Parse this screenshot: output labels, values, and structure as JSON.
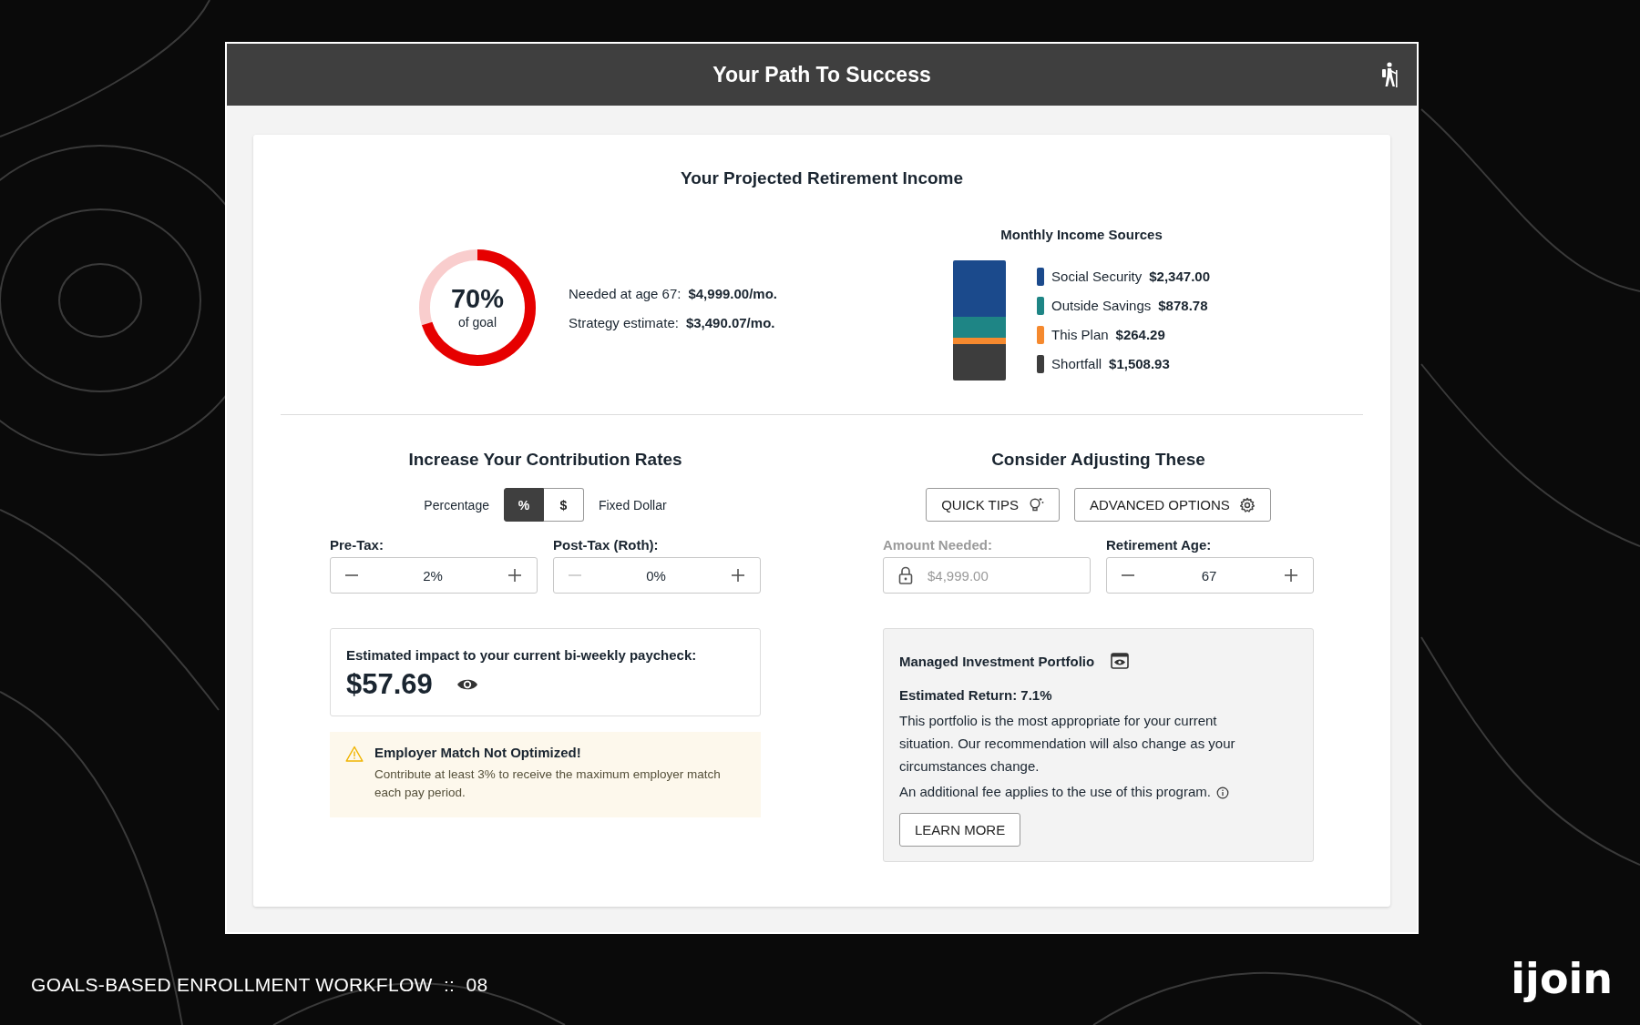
{
  "slide": {
    "caption": "GOALS-BASED ENROLLMENT WORKFLOW  ::  08",
    "logo": "ijoin"
  },
  "window": {
    "title": "Your Path To Success"
  },
  "projection": {
    "title": "Your Projected Retirement Income",
    "goal": {
      "percent": "70%",
      "caption": "of goal",
      "level": 0.7
    },
    "facts": [
      {
        "label": "Needed at age 67:",
        "value": "$4,999.00/mo."
      },
      {
        "label": "Strategy estimate:",
        "value": "$3,490.07/mo."
      }
    ],
    "sources": {
      "title": "Monthly Income Sources",
      "items": [
        {
          "name": "Social Security",
          "amount": "$2,347.00",
          "color": "#1b4a8c"
        },
        {
          "name": "Outside Savings",
          "amount": "$878.78",
          "color": "#1e8585"
        },
        {
          "name": "This Plan",
          "amount": "$264.29",
          "color": "#f5892e"
        },
        {
          "name": "Shortfall",
          "amount": "$1,508.93",
          "color": "#3d3d3d"
        }
      ]
    }
  },
  "contributions": {
    "title": "Increase Your Contribution Rates",
    "toggle": {
      "left_label": "Percentage",
      "right_label": "Fixed Dollar",
      "options": [
        {
          "label": "%",
          "selected": true
        },
        {
          "label": "$",
          "selected": false
        }
      ]
    },
    "steppers": [
      {
        "label": "Pre-Tax:",
        "value": "2%",
        "minus_disabled": false
      },
      {
        "label": "Post-Tax (Roth):",
        "value": "0%",
        "minus_disabled": true
      }
    ],
    "impact": {
      "label": "Estimated impact to your current bi-weekly paycheck:",
      "amount": "$57.69"
    },
    "alert": {
      "title": "Employer Match Not Optimized!",
      "text": "Contribute at least 3% to receive the maximum employer match each pay period."
    }
  },
  "adjust": {
    "title": "Consider Adjusting These",
    "buttons": [
      {
        "label": "QUICK TIPS",
        "kind": "tips"
      },
      {
        "label": "ADVANCED OPTIONS",
        "kind": "settings"
      }
    ],
    "fields": [
      {
        "kind": "locked",
        "label": "Amount Needed:",
        "value": "$4,999.00",
        "disabled": true
      },
      {
        "kind": "stepper",
        "label": "Retirement Age:",
        "value": "67",
        "disabled": false
      }
    ],
    "portfolio": {
      "title": "Managed Investment Portfolio",
      "return": "Estimated Return: 7.1%",
      "description": "This portfolio is the most appropriate for your current situation. Our recommendation will also change as your circumstances change.",
      "fee_note": "An additional fee applies to the use of this program.",
      "button": "LEARN MORE"
    }
  }
}
